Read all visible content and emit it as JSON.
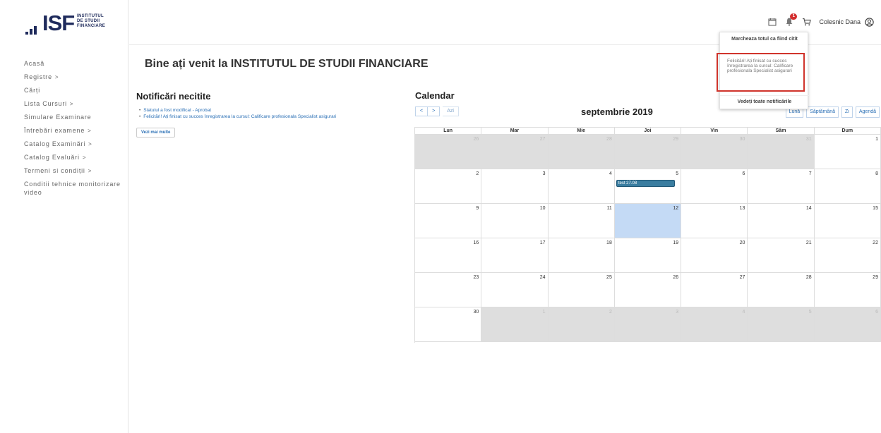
{
  "logo": {
    "mark": "ISF",
    "line1": "INSTITUTUL",
    "line2": "DE STUDII",
    "line3": "FINANCIARE"
  },
  "sidebar": {
    "items": [
      {
        "label": "Acasă",
        "arrow": ""
      },
      {
        "label": "Registre",
        "arrow": ">"
      },
      {
        "label": "Cărți",
        "arrow": ""
      },
      {
        "label": "Lista Cursuri",
        "arrow": ">"
      },
      {
        "label": "Simulare Examinare",
        "arrow": ""
      },
      {
        "label": "Întrebări examene",
        "arrow": ">"
      },
      {
        "label": "Catalog Examinări",
        "arrow": ">"
      },
      {
        "label": "Catalog Evaluări",
        "arrow": ">"
      },
      {
        "label": "Termeni si condiții",
        "arrow": ">"
      },
      {
        "label": "Conditii tehnice monitorizare video",
        "arrow": ""
      }
    ]
  },
  "topbar": {
    "notification_count": "1",
    "user_name": "Colesnic Dana"
  },
  "welcome": "Bine ați venit la INSTITUTUL DE STUDII FINANCIARE",
  "notifications": {
    "title": "Notificări necitite",
    "items": [
      "Statutul a fost modificat - Aprobat",
      "Felicitări! Ați finisat cu succes înregistrarea la cursul: Calificare profesionala Specialist asigurari"
    ],
    "more_label": "Vezi mai multe"
  },
  "calendar": {
    "title": "Calendar",
    "prev": "<",
    "next": ">",
    "today_label": "Azi",
    "month_label": "septembrie 2019",
    "views": [
      "Lună",
      "Săptămână",
      "Zi",
      "Agendă"
    ],
    "weekdays": [
      "Lun",
      "Mar",
      "Mie",
      "Joi",
      "Vin",
      "Sâm",
      "Dum"
    ],
    "weeks": [
      [
        {
          "d": "26",
          "o": 1
        },
        {
          "d": "27",
          "o": 1
        },
        {
          "d": "28",
          "o": 1
        },
        {
          "d": "29",
          "o": 1
        },
        {
          "d": "30",
          "o": 1
        },
        {
          "d": "31",
          "o": 1
        },
        {
          "d": "1",
          "o": 0
        }
      ],
      [
        {
          "d": "2",
          "o": 0
        },
        {
          "d": "3",
          "o": 0
        },
        {
          "d": "4",
          "o": 0
        },
        {
          "d": "5",
          "o": 0,
          "event": "test 27.08"
        },
        {
          "d": "6",
          "o": 0
        },
        {
          "d": "7",
          "o": 0
        },
        {
          "d": "8",
          "o": 0
        }
      ],
      [
        {
          "d": "9",
          "o": 0
        },
        {
          "d": "10",
          "o": 0
        },
        {
          "d": "11",
          "o": 0
        },
        {
          "d": "12",
          "o": 0,
          "today": 1
        },
        {
          "d": "13",
          "o": 0
        },
        {
          "d": "14",
          "o": 0
        },
        {
          "d": "15",
          "o": 0
        }
      ],
      [
        {
          "d": "16",
          "o": 0
        },
        {
          "d": "17",
          "o": 0
        },
        {
          "d": "18",
          "o": 0
        },
        {
          "d": "19",
          "o": 0
        },
        {
          "d": "20",
          "o": 0
        },
        {
          "d": "21",
          "o": 0
        },
        {
          "d": "22",
          "o": 0
        }
      ],
      [
        {
          "d": "23",
          "o": 0
        },
        {
          "d": "24",
          "o": 0
        },
        {
          "d": "25",
          "o": 0
        },
        {
          "d": "26",
          "o": 0
        },
        {
          "d": "27",
          "o": 0
        },
        {
          "d": "28",
          "o": 0
        },
        {
          "d": "29",
          "o": 0
        }
      ],
      [
        {
          "d": "30",
          "o": 0
        },
        {
          "d": "1",
          "o": 1
        },
        {
          "d": "2",
          "o": 1
        },
        {
          "d": "3",
          "o": 1
        },
        {
          "d": "4",
          "o": 1
        },
        {
          "d": "5",
          "o": 1
        },
        {
          "d": "6",
          "o": 1
        }
      ]
    ]
  },
  "notif_dropdown": {
    "mark_all": "Marcheaza totul ca fiind citit",
    "item": "Felicitări! Ați finisat cu succes înregistrarea la cursul: Calificare profesionala Specialist asigurari",
    "view_all": "Vedeți toate notificările"
  },
  "colors": {
    "brand_navy": "#1f2b5c",
    "brand_red": "#e03a3e",
    "link": "#2a6fb5",
    "event": "#3a7da0",
    "today_bg": "#c4daf5",
    "highlight": "#d0342c"
  }
}
